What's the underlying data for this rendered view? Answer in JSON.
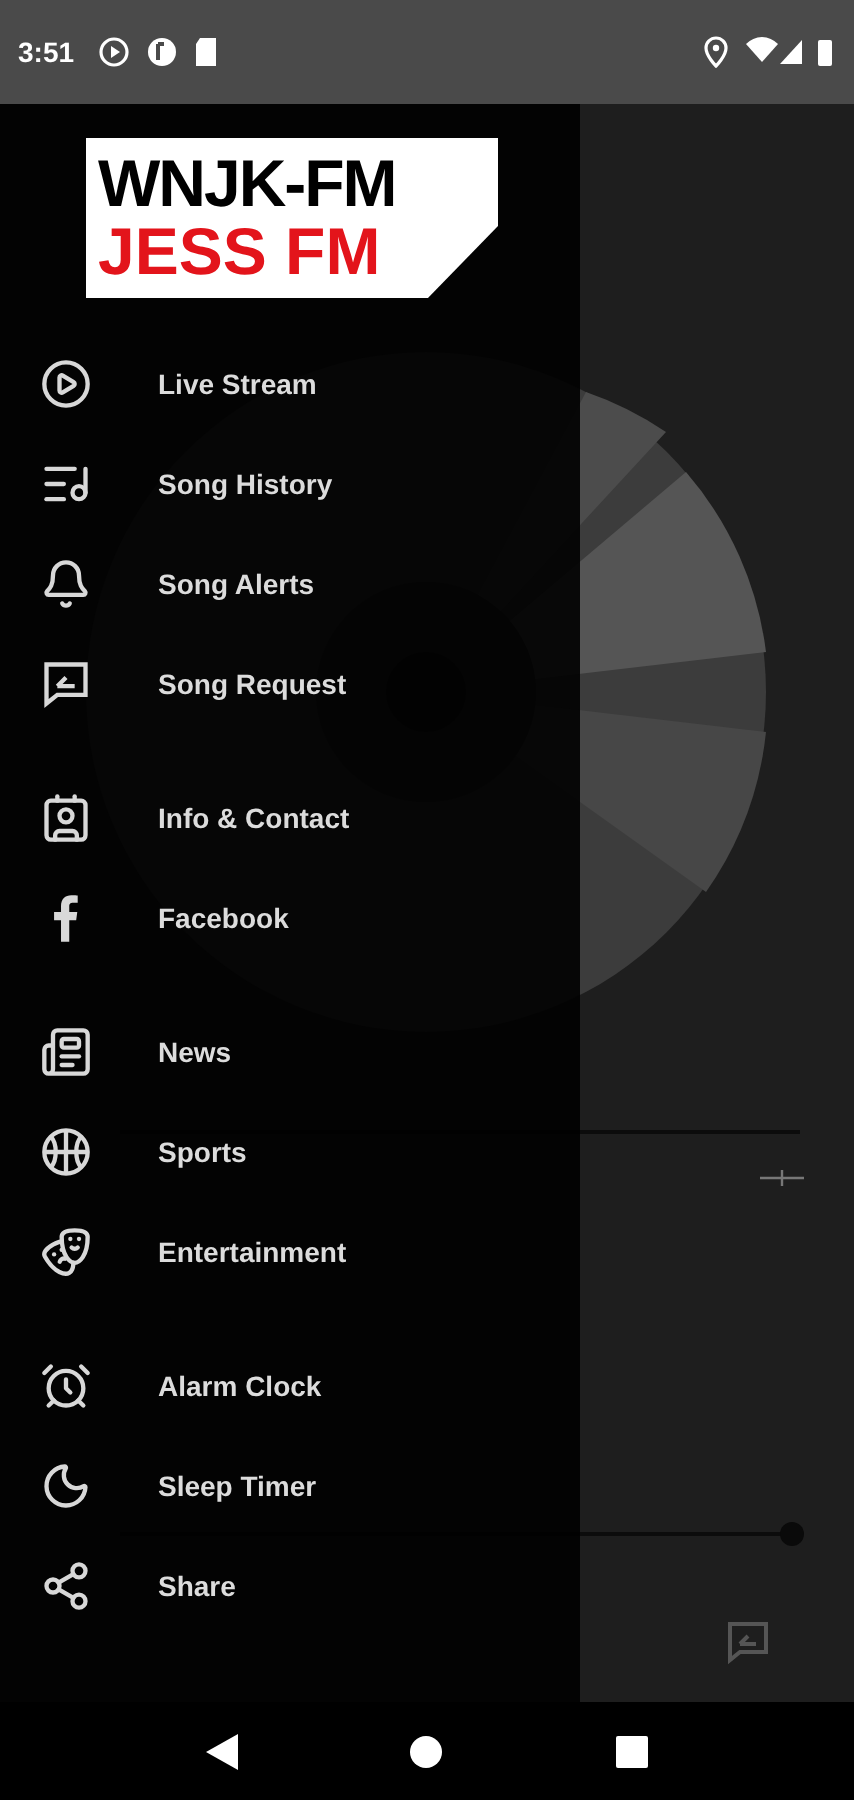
{
  "status_bar": {
    "time": "3:51"
  },
  "logo": {
    "line_1": "WNJK-FM",
    "line_2": "JESS FM"
  },
  "drawer": {
    "groups": [
      {
        "items": [
          {
            "label": "Live Stream",
            "kind": "play"
          },
          {
            "label": "Song History",
            "kind": "history"
          },
          {
            "label": "Song Alerts",
            "kind": "bell"
          },
          {
            "label": "Song Request",
            "kind": "request"
          }
        ]
      },
      {
        "items": [
          {
            "label": "Info & Contact",
            "kind": "contact"
          },
          {
            "label": "Facebook",
            "kind": "facebook"
          }
        ]
      },
      {
        "items": [
          {
            "label": "News",
            "kind": "news"
          },
          {
            "label": "Sports",
            "kind": "sports"
          },
          {
            "label": "Entertainment",
            "kind": "entertainment"
          }
        ]
      },
      {
        "items": [
          {
            "label": "Alarm Clock",
            "kind": "alarm"
          },
          {
            "label": "Sleep Timer",
            "kind": "sleep"
          },
          {
            "label": "Share",
            "kind": "share"
          }
        ]
      }
    ]
  },
  "player": {
    "volume": {
      "level": 1
    }
  }
}
